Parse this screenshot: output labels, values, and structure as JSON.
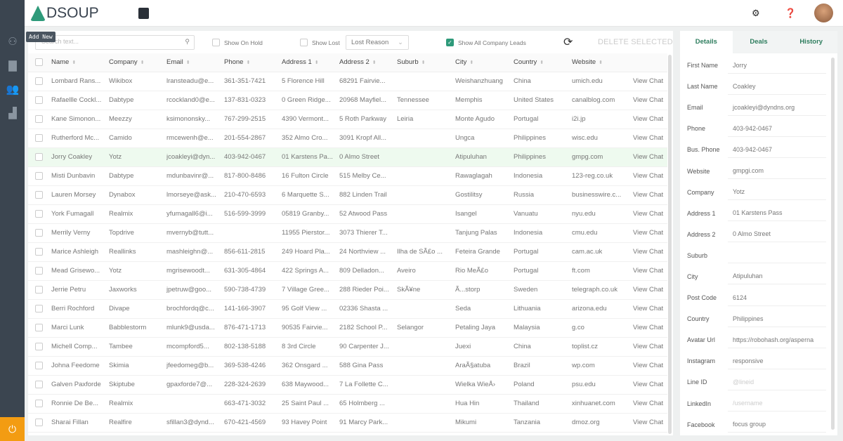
{
  "app": {
    "logo": "DSOUP",
    "tooltip": "Add New"
  },
  "toolbar": {
    "search_placeholder": "Search text...",
    "show_on_hold": "Show On Hold",
    "show_lost": "Show Lost",
    "lost_reason": "Lost Reason",
    "show_all": "Show All Company Leads",
    "delete": "DELETE SELECTED"
  },
  "columns": [
    "Name",
    "Company",
    "Email",
    "Phone",
    "Address 1",
    "Address 2",
    "Suburb",
    "City",
    "Country",
    "Website"
  ],
  "view_chat": "View Chat",
  "rows": [
    [
      "Lombard Rans...",
      "Wikibox",
      "lransteadu@e...",
      "361-351-7421",
      "5 Florence Hill",
      "68291 Fairvie...",
      "",
      "Weishanzhuang",
      "China",
      "umich.edu"
    ],
    [
      "Rafaellle Cockl...",
      "Dabtype",
      "rcockland0@e...",
      "137-831-0323",
      "0 Green Ridge...",
      "20968 Mayfiel...",
      "Tennessee",
      "Memphis",
      "United States",
      "canalblog.com"
    ],
    [
      "Kane Simonon...",
      "Meezzy",
      "ksimononsky...",
      "767-299-2515",
      "4390 Vermont...",
      "5 Roth Parkway",
      "Leiria",
      "Monte Agudo",
      "Portugal",
      "i2i.jp"
    ],
    [
      "Rutherford Mc...",
      "Camido",
      "rmcewenh@e...",
      "201-554-2867",
      "352 Almo Cro...",
      "3091 Kropf All...",
      "",
      "Ungca",
      "Philippines",
      "wisc.edu"
    ],
    [
      "Jorry Coakley",
      "Yotz",
      "jcoakleyi@dyn...",
      "403-942-0467",
      "01 Karstens Pa...",
      "0 Almo Street",
      "",
      "Atipuluhan",
      "Philippines",
      "gmpg.com"
    ],
    [
      "Misti Dunbavin",
      "Dabtype",
      "mdunbavinr@...",
      "817-800-8486",
      "16 Fulton Circle",
      "515 Melby Ce...",
      "",
      "Rawaglagah",
      "Indonesia",
      "123-reg.co.uk"
    ],
    [
      "Lauren Morsey",
      "Dynabox",
      "lmorseye@ask...",
      "210-470-6593",
      "6 Marquette S...",
      "882 Linden Trail",
      "",
      "Gostilitsy",
      "Russia",
      "businesswire.c..."
    ],
    [
      "York Fumagall",
      "Realmix",
      "yfumagall6@i...",
      "516-599-3999",
      "05819 Granby...",
      "52 Atwood Pass",
      "",
      "Isangel",
      "Vanuatu",
      "nyu.edu"
    ],
    [
      "Merrily Verny",
      "Topdrive",
      "mvernyb@tutt...",
      "",
      "11955 Pierstor...",
      "3073 Thierer T...",
      "",
      "Tanjung Palas",
      "Indonesia",
      "cmu.edu"
    ],
    [
      "Marice Ashleigh",
      "Reallinks",
      "mashleighn@...",
      "856-611-2815",
      "249 Hoard Pla...",
      "24 Northview ...",
      "Ilha de SÃ£o ...",
      "Feteira Grande",
      "Portugal",
      "cam.ac.uk"
    ],
    [
      "Mead Grisewo...",
      "Yotz",
      "mgrisewoodt...",
      "631-305-4864",
      "422 Springs A...",
      "809 Delladon...",
      "Aveiro",
      "Rio MeÃ£o",
      "Portugal",
      "ft.com"
    ],
    [
      "Jerrie Petru",
      "Jaxworks",
      "jpetruw@goo...",
      "590-738-4739",
      "7 Village Gree...",
      "288 Rieder Poi...",
      "SkÃ¥ne",
      "Ã...storp",
      "Sweden",
      "telegraph.co.uk"
    ],
    [
      "Berri Rochford",
      "Divape",
      "brochfordq@c...",
      "141-166-3907",
      "95 Golf View ...",
      "02336 Shasta ...",
      "",
      "Seda",
      "Lithuania",
      "arizona.edu"
    ],
    [
      "Marci Lunk",
      "Babblestorm",
      "mlunk9@usda...",
      "876-471-1713",
      "90535 Fairvie...",
      "2182 School P...",
      "Selangor",
      "Petaling Jaya",
      "Malaysia",
      "g.co"
    ],
    [
      "Michell Comp...",
      "Tambee",
      "mcompford5...",
      "802-138-5188",
      "8 3rd Circle",
      "90 Carpenter J...",
      "",
      "Juexi",
      "China",
      "toplist.cz"
    ],
    [
      "Johna Feedome",
      "Skimia",
      "jfeedomeg@b...",
      "369-538-4246",
      "362 Onsgard ...",
      "588 Gina Pass",
      "",
      "AraÃ§atuba",
      "Brazil",
      "wp.com"
    ],
    [
      "Galven Paxforde",
      "Skiptube",
      "gpaxforde7@...",
      "228-324-2639",
      "638 Maywood...",
      "7 La Follette C...",
      "",
      "Wielka WieÅ›",
      "Poland",
      "psu.edu"
    ],
    [
      "Ronnie De Be...",
      "Realmix",
      "",
      "663-471-3032",
      "25 Saint Paul ...",
      "65 Holmberg ...",
      "",
      "Hua Hin",
      "Thailand",
      "xinhuanet.com"
    ],
    [
      "Sharai Fillan",
      "Realfire",
      "sfillan3@dynd...",
      "670-421-4569",
      "93 Havey Point",
      "91 Marcy Park...",
      "",
      "Mikumi",
      "Tanzania",
      "dmoz.org"
    ]
  ],
  "details": {
    "tabs": [
      "Details",
      "Deals",
      "History"
    ],
    "fields": [
      [
        "First Name",
        "Jorry"
      ],
      [
        "Last Name",
        "Coakley"
      ],
      [
        "Email",
        "jcoakleyi@dyndns.org"
      ],
      [
        "Phone",
        "403-942-0467"
      ],
      [
        "Bus. Phone",
        "403-942-0467"
      ],
      [
        "Website",
        "gmpgi.com"
      ],
      [
        "Company",
        "Yotz"
      ],
      [
        "Address 1",
        "01 Karstens Pass"
      ],
      [
        "Address 2",
        "0 Almo Street"
      ],
      [
        "Suburb",
        ""
      ],
      [
        "City",
        "Atipuluhan"
      ],
      [
        "Post Code",
        "6124"
      ],
      [
        "Country",
        "Philippines"
      ],
      [
        "Avatar Url",
        "https://robohash.org/asperna"
      ],
      [
        "Instagram",
        "responsive"
      ],
      [
        "Line ID",
        ""
      ],
      [
        "LinkedIn",
        ""
      ],
      [
        "Facebook",
        "focus group"
      ]
    ],
    "placeholders": {
      "Line ID": "@lineid",
      "LinkedIn": "/username"
    }
  }
}
